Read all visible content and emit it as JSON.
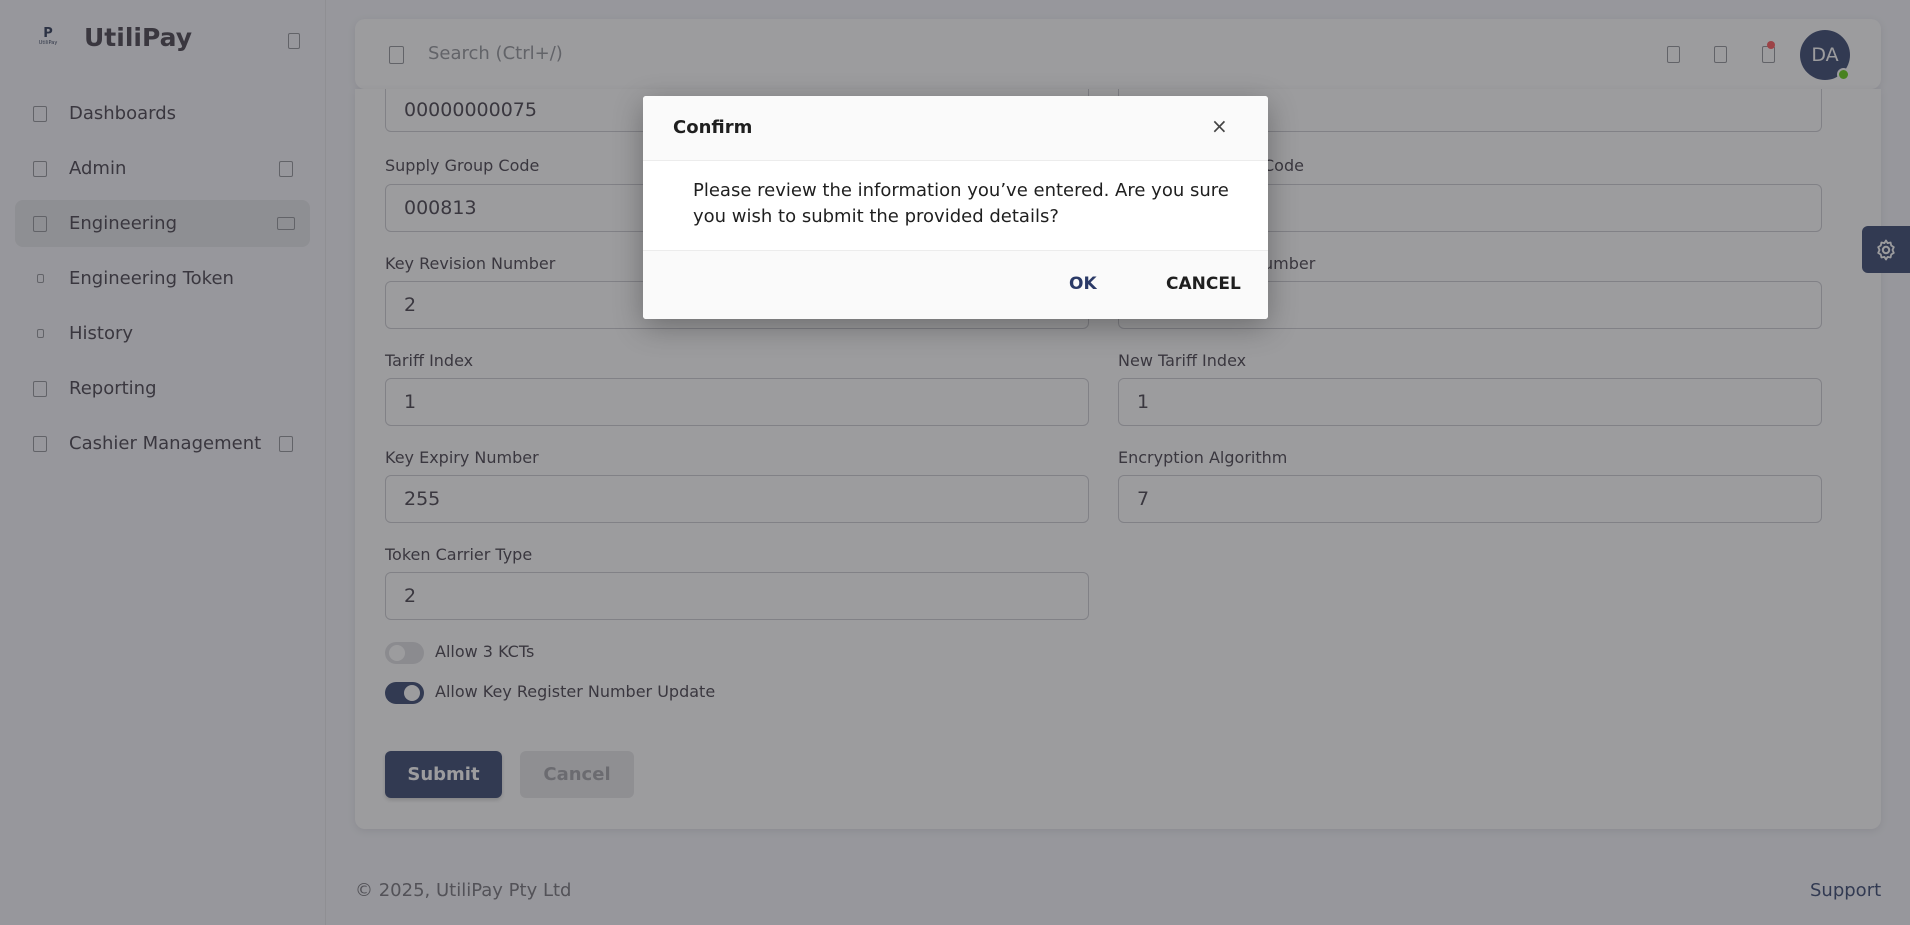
{
  "brand": {
    "name": "UtiliPay",
    "logo_mark": "P",
    "logo_sub": "UtiliPay"
  },
  "sidebar": {
    "items": [
      {
        "label": "Dashboards",
        "icon": "dashboard-icon",
        "has_caret": false
      },
      {
        "label": "Admin",
        "icon": "admin-icon",
        "has_caret": true
      },
      {
        "label": "Engineering",
        "icon": "engineering-icon",
        "has_caret": true,
        "active": true
      },
      {
        "label": "Engineering Token",
        "icon": "dot-icon",
        "has_caret": false
      },
      {
        "label": "History",
        "icon": "dot-icon",
        "has_caret": false
      },
      {
        "label": "Reporting",
        "icon": "reporting-icon",
        "has_caret": false
      },
      {
        "label": "Cashier Management",
        "icon": "cashier-icon",
        "has_caret": true
      }
    ]
  },
  "header": {
    "search_placeholder": "Search (Ctrl+/)",
    "avatar_initials": "DA"
  },
  "form": {
    "top_value_left": "00000000075",
    "fields": {
      "supply_group_code": {
        "label": "Supply Group Code",
        "value": "000813"
      },
      "new_supply_group_code_partial": "Code",
      "key_revision_number": {
        "label": "Key Revision Number",
        "value": "2"
      },
      "new_key_revision_number_partial": "umber",
      "tariff_index": {
        "label": "Tariff Index",
        "value": "1"
      },
      "new_tariff_index": {
        "label": "New Tariff Index",
        "value": "1"
      },
      "key_expiry_number": {
        "label": "Key Expiry Number",
        "value": "255"
      },
      "encryption_algorithm": {
        "label": "Encryption Algorithm",
        "value": "7"
      },
      "token_carrier_type": {
        "label": "Token Carrier Type",
        "value": "2"
      }
    },
    "toggles": {
      "allow_3_kcts": {
        "label": "Allow 3 KCTs",
        "on": false
      },
      "allow_krn_update": {
        "label": "Allow Key Register Number Update",
        "on": true
      }
    },
    "submit_label": "Submit",
    "cancel_label": "Cancel"
  },
  "footer": {
    "copyright": "© 2025, UtiliPay Pty Ltd",
    "support": "Support"
  },
  "dialog": {
    "title": "Confirm",
    "close": "×",
    "message": "Please review the information you’ve entered. Are you sure you wish to submit the provided details?",
    "ok_label": "OK",
    "cancel_label": "CANCEL"
  },
  "colors": {
    "primary": "#2b3a67",
    "overlay": "#3a3a3e",
    "status_online": "#56ca00",
    "notification": "#ff4c51"
  }
}
